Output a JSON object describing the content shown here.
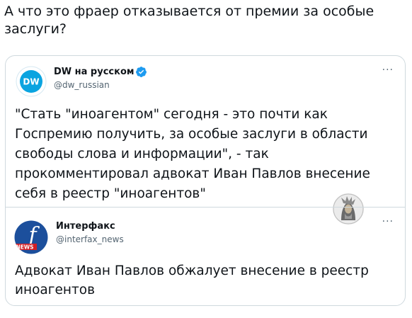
{
  "post": {
    "text": "А что это фраер отказывается от премии за особые заслуги?"
  },
  "embedded_tweet": {
    "author": {
      "name": "DW на русском",
      "handle": "@dw_russian",
      "verified": true,
      "avatar_icon": "dw-logo-icon",
      "avatar_text": "DW"
    },
    "text": "\"Стать \"иноагентом\" сегодня - это почти как Госпремию получить, за особые заслуги в области свободы слова и информации\", - так прокомментировал адвокат Иван Павлов внесение себя в реестр \"иноагентов\"",
    "more_label": "···"
  },
  "quoted_tweet": {
    "author": {
      "name": "Интерфакс",
      "handle": "@interfax_news",
      "avatar_icon": "interfax-logo-icon",
      "avatar_badge": "NEWS"
    },
    "text": "Адвокат Иван Павлов обжалует внесение в реестр иноагентов",
    "more_label": "···"
  },
  "colors": {
    "text": "#0f1419",
    "secondary": "#536471",
    "border": "#cfd9de",
    "verified": "#1d9bf0",
    "dw_blue": "#0aa4e0",
    "interfax_blue": "#1c4f9c",
    "interfax_red": "#d21f26"
  }
}
